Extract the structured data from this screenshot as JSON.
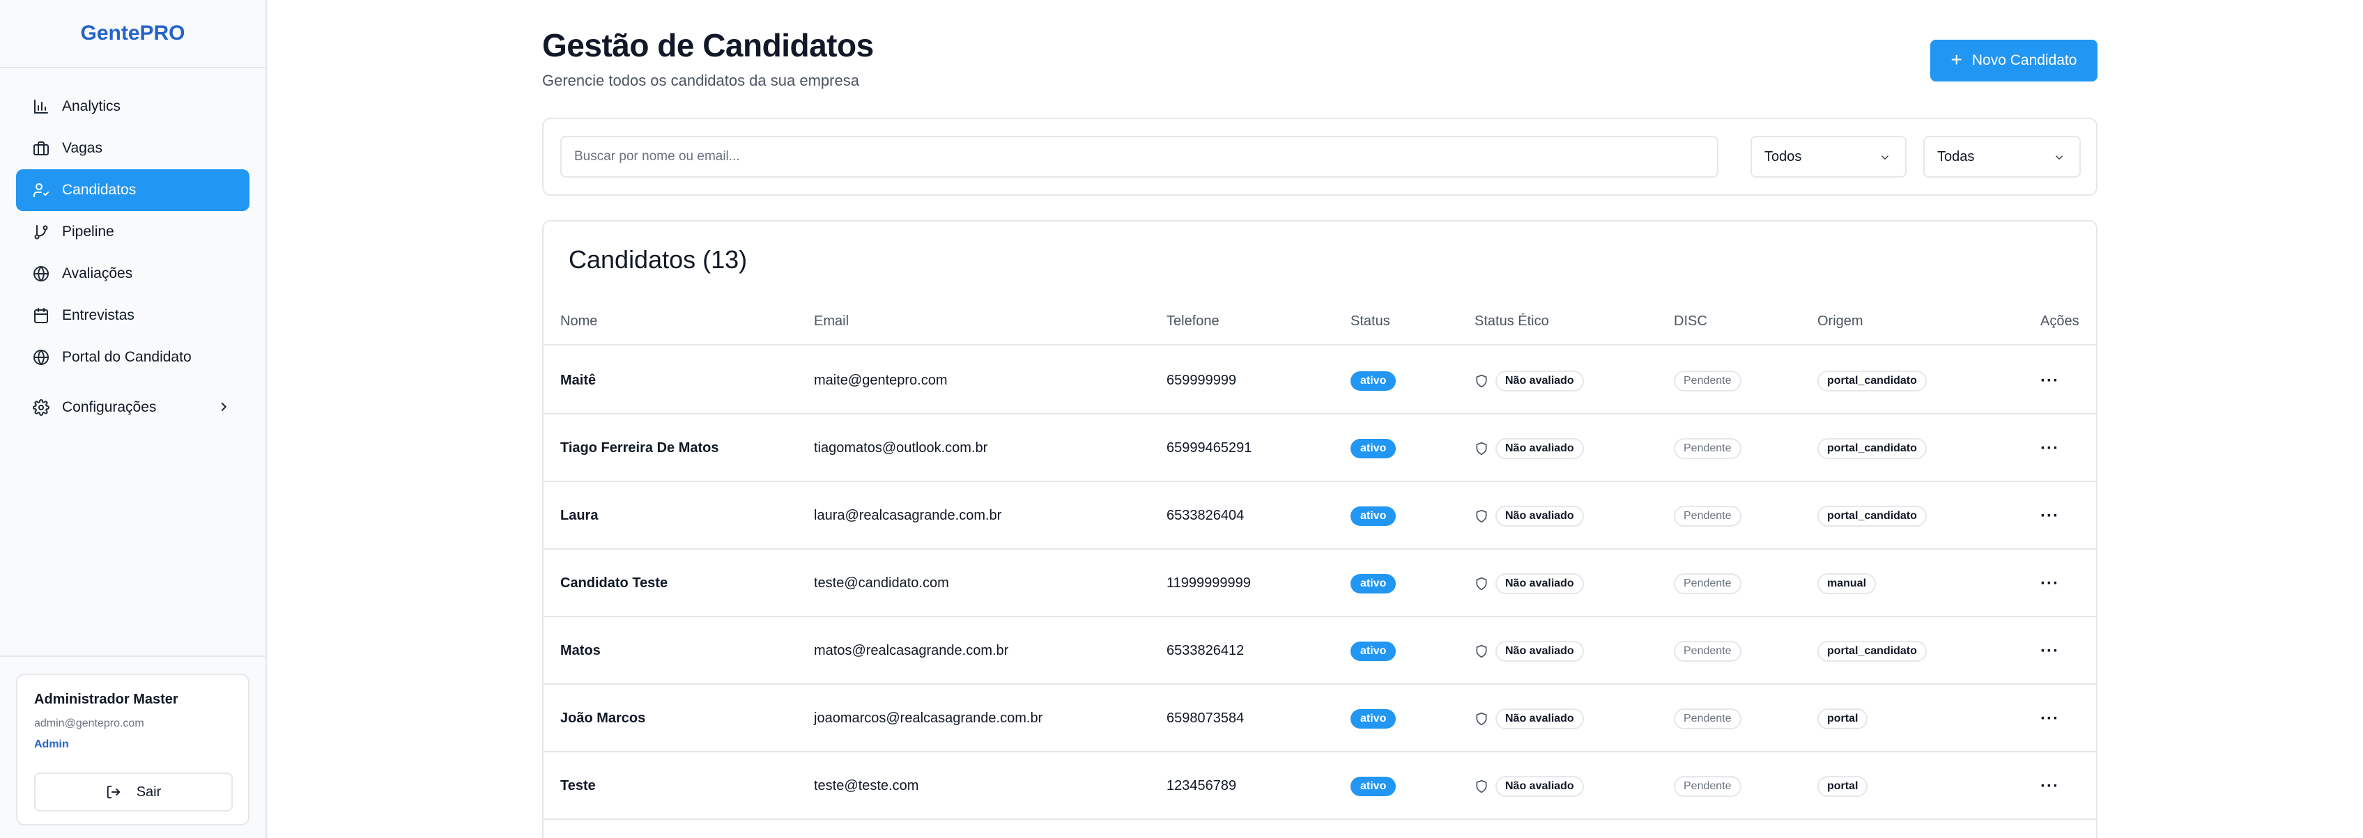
{
  "sidebar": {
    "brand": "GentePRO",
    "items": [
      {
        "label": "Analytics",
        "icon": "bar-chart-icon"
      },
      {
        "label": "Vagas",
        "icon": "briefcase-icon"
      },
      {
        "label": "Candidatos",
        "icon": "user-check-icon",
        "active": true
      },
      {
        "label": "Pipeline",
        "icon": "git-branch-icon"
      },
      {
        "label": "Avaliações",
        "icon": "globe-icon"
      },
      {
        "label": "Entrevistas",
        "icon": "calendar-icon"
      },
      {
        "label": "Portal do Candidato",
        "icon": "globe-icon"
      },
      {
        "label": "Configurações",
        "icon": "gear-icon"
      }
    ],
    "user": {
      "name": "Administrador Master",
      "email": "admin@gentepro.com",
      "role": "Admin",
      "logout_label": "Sair"
    }
  },
  "header": {
    "title": "Gestão de Candidatos",
    "subtitle": "Gerencie todos os candidatos da sua empresa",
    "new_button_label": "Novo Candidato"
  },
  "filters": {
    "search_placeholder": "Buscar por nome ou email...",
    "status_value": "Todos",
    "origin_value": "Todas"
  },
  "table": {
    "title": "Candidatos (13)",
    "columns": [
      "Nome",
      "Email",
      "Telefone",
      "Status",
      "Status Ético",
      "DISC",
      "Origem",
      "Ações"
    ],
    "rows": [
      {
        "nome": "Maitê",
        "email": "maite@gentepro.com",
        "telefone": "659999999",
        "status": "ativo",
        "etico": "Não avaliado",
        "disc": "Pendente",
        "origem": "portal_candidato"
      },
      {
        "nome": "Tiago Ferreira De Matos",
        "email": "tiagomatos@outlook.com.br",
        "telefone": "65999465291",
        "status": "ativo",
        "etico": "Não avaliado",
        "disc": "Pendente",
        "origem": "portal_candidato"
      },
      {
        "nome": "Laura",
        "email": "laura@realcasagrande.com.br",
        "telefone": "6533826404",
        "status": "ativo",
        "etico": "Não avaliado",
        "disc": "Pendente",
        "origem": "portal_candidato"
      },
      {
        "nome": "Candidato Teste",
        "email": "teste@candidato.com",
        "telefone": "11999999999",
        "status": "ativo",
        "etico": "Não avaliado",
        "disc": "Pendente",
        "origem": "manual"
      },
      {
        "nome": "Matos",
        "email": "matos@realcasagrande.com.br",
        "telefone": "6533826412",
        "status": "ativo",
        "etico": "Não avaliado",
        "disc": "Pendente",
        "origem": "portal_candidato"
      },
      {
        "nome": "João Marcos",
        "email": "joaomarcos@realcasagrande.com.br",
        "telefone": "6598073584",
        "status": "ativo",
        "etico": "Não avaliado",
        "disc": "Pendente",
        "origem": "portal"
      },
      {
        "nome": "Teste",
        "email": "teste@teste.com",
        "telefone": "123456789",
        "status": "ativo",
        "etico": "Não avaliado",
        "disc": "Pendente",
        "origem": "portal"
      }
    ]
  },
  "colors": {
    "accent": "#2196f3",
    "brand": "#2563c9",
    "border": "#e5e7eb"
  }
}
